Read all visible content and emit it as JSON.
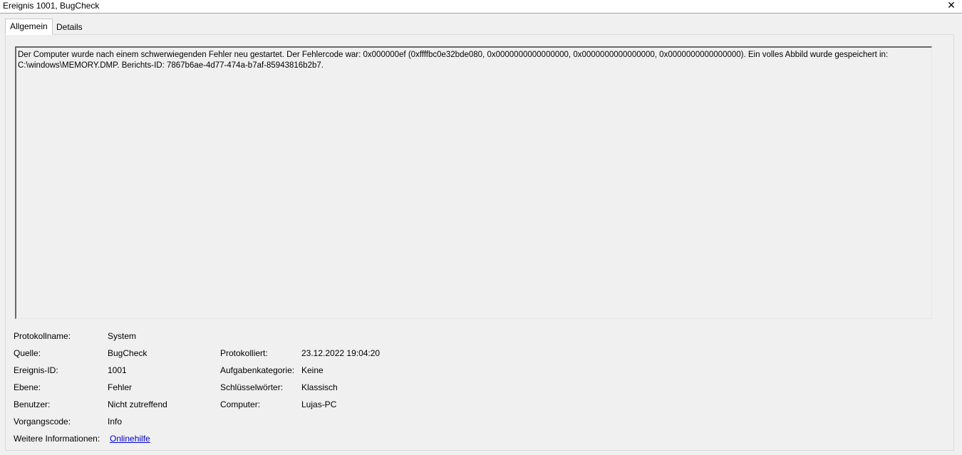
{
  "window": {
    "title": "Ereignis 1001, BugCheck",
    "close_glyph": "✕"
  },
  "tabs": [
    {
      "label": "Allgemein",
      "active": true
    },
    {
      "label": "Details",
      "active": false
    }
  ],
  "description": "Der Computer wurde nach einem schwerwiegenden Fehler neu gestartet. Der Fehlercode war: 0x000000ef (0xffffbc0e32bde080, 0x0000000000000000, 0x0000000000000000, 0x0000000000000000). Ein volles Abbild wurde gespeichert in: C:\\windows\\MEMORY.DMP. Berichts-ID: 7867b6ae-4d77-474a-b7af-85943816b2b7.",
  "details": {
    "log_name_label": "Protokollname:",
    "log_name": "System",
    "source_label": "Quelle:",
    "source": "BugCheck",
    "logged_label": "Protokolliert:",
    "logged": "23.12.2022 19:04:20",
    "event_id_label": "Ereignis-ID:",
    "event_id": "1001",
    "task_category_label": "Aufgabenkategorie:",
    "task_category": "Keine",
    "level_label": "Ebene:",
    "level": "Fehler",
    "keywords_label": "Schlüsselwörter:",
    "keywords": "Klassisch",
    "user_label": "Benutzer:",
    "user": "Nicht zutreffend",
    "computer_label": "Computer:",
    "computer": "Lujas-PC",
    "opcode_label": "Vorgangscode:",
    "opcode": "Info",
    "more_info_label": "Weitere Informationen:",
    "more_info_link": "Onlinehilfe"
  },
  "colors": {
    "background": "#f0f0f0",
    "link": "#0000cc"
  }
}
